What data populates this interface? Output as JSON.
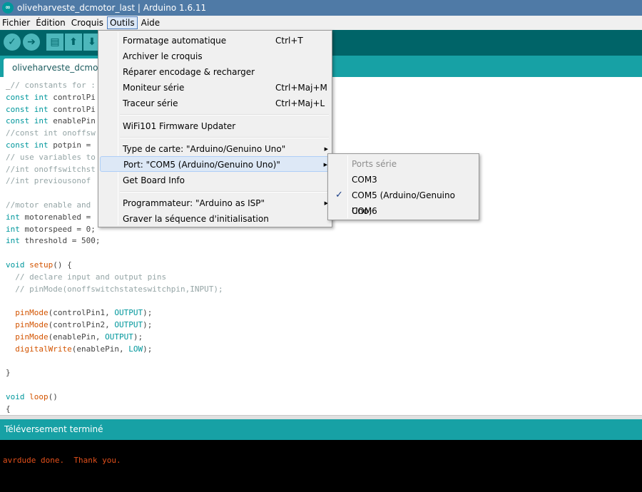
{
  "window": {
    "title": "oliveharveste_dcmotor_last | Arduino 1.6.11",
    "icon": "arduino-logo-icon"
  },
  "menubar": {
    "items": [
      "Fichier",
      "Édition",
      "Croquis",
      "Outils",
      "Aide"
    ],
    "active": "Outils"
  },
  "toolbar": {
    "buttons": [
      "verify-icon",
      "upload-icon",
      "new-icon",
      "open-icon",
      "save-icon"
    ],
    "glyphs": [
      "✓",
      "➔",
      "▤",
      "⬆",
      "⬇"
    ]
  },
  "tabs": [
    {
      "label": "oliveharveste_dcmoto"
    }
  ],
  "editor": {
    "lines": [
      "_// constants for :",
      "const int controlPi",
      "const int controlPi",
      "const int enablePin",
      "//const int onoffsw",
      "const int potpin =",
      "// use variables to",
      "//int onoffswitchst",
      "//int previousonof",
      "",
      "//motor enable and",
      "int motorenabled =",
      "int motorspeed = 0;",
      "int threshold = 500;",
      "",
      "void setup() {",
      "  // declare input and output pins",
      "  // pinMode(onoffswitchstateswitchpin,INPUT);",
      "",
      "  pinMode(controlPin1, OUTPUT);",
      "  pinMode(controlPin2, OUTPUT);",
      "  pinMode(enablePin, OUTPUT);",
      "  digitalWrite(enablePin, LOW);",
      "",
      "}",
      "",
      "void loop()",
      "{"
    ]
  },
  "status": {
    "text": "Téléversement terminé"
  },
  "console": {
    "message": "avrdude done.  Thank you."
  },
  "tools_menu": {
    "items": [
      {
        "label": "Formatage automatique",
        "shortcut": "Ctrl+T"
      },
      {
        "label": "Archiver le croquis",
        "shortcut": ""
      },
      {
        "label": "Réparer encodage & recharger",
        "shortcut": ""
      },
      {
        "label": "Moniteur série",
        "shortcut": "Ctrl+Maj+M"
      },
      {
        "label": "Traceur série",
        "shortcut": "Ctrl+Maj+L"
      },
      {
        "label": "WiFi101 Firmware Updater",
        "shortcut": ""
      },
      {
        "label": "Type de carte: \"Arduino/Genuino Uno\"",
        "shortcut": ""
      },
      {
        "label": "Port: \"COM5 (Arduino/Genuino Uno)\"",
        "shortcut": ""
      },
      {
        "label": "Get Board Info",
        "shortcut": ""
      },
      {
        "label": "Programmateur: \"Arduino as ISP\"",
        "shortcut": ""
      },
      {
        "label": "Graver la séquence d'initialisation",
        "shortcut": ""
      }
    ],
    "highlighted": "Port: \"COM5 (Arduino/Genuino Uno)\""
  },
  "port_submenu": {
    "header": "Ports série",
    "items": [
      "COM3",
      "COM5 (Arduino/Genuino Uno)",
      "COM6"
    ],
    "selected": "COM5 (Arduino/Genuino Uno)"
  },
  "colors": {
    "toolbar": "#006468",
    "tabstrip": "#17a1a5",
    "status": "#17a1a5",
    "console_text": "#e3501b",
    "keyword": "#00979c",
    "function": "#d35400"
  }
}
